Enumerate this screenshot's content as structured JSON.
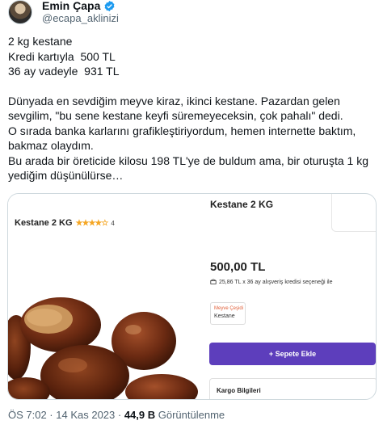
{
  "author": {
    "name": "Emin Çapa",
    "handle": "@ecapa_aklinizi"
  },
  "tweet": {
    "lines": [
      "2 kg kestane",
      "Kredi kartıyla  500 TL",
      "36 ay vadeyle  931 TL",
      "",
      "Dünyada en sevdiğim meyve kiraz, ikinci kestane. Pazardan gelen sevgilim, \"bu sene kestane keyfi süremeyeceksin, çok pahalı\" dedi.",
      "O sırada banka karlarını grafikleştiriyordum, hemen internette baktım, bakmaz olaydım.",
      "Bu arada bir öreticide kilosu 198 TL'ye de buldum ama, bir oturuşta 1 kg yediğim düşünülürse…"
    ]
  },
  "card": {
    "left_title": "Kestane 2 KG",
    "stars": "★★★★☆",
    "rating": "4",
    "right_title": "Kestane 2 KG",
    "price": "500,00 TL",
    "credit": "25,86 TL x 36 ay alışveriş kredisi seçeneği ile",
    "variant_label": "Meyve Çeşidi",
    "variant_value": "Kestane",
    "add_button": "+ Sepete Ekle",
    "cargo_label": "Kargo Bilgileri"
  },
  "meta": {
    "time": "ÖS 7:02 · 14 Kas 2023 ·",
    "views": "44,9 B",
    "views_label": "Görüntülenme"
  },
  "colors": {
    "accent": "#5d3ebc",
    "verified": "#1d9bf0",
    "star": "#f5a623"
  }
}
